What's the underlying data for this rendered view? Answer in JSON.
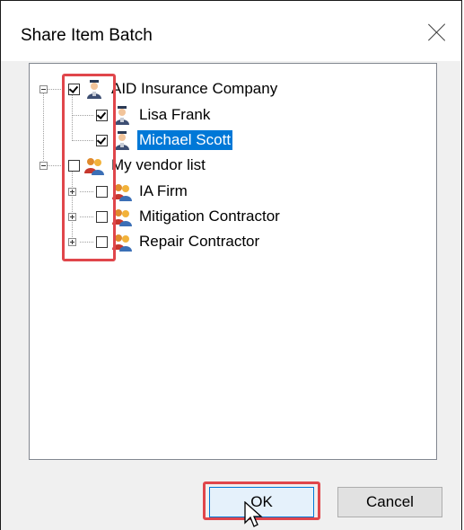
{
  "dialog": {
    "title": "Share Item Batch",
    "close_icon": "close-icon"
  },
  "tree": {
    "items": [
      {
        "label": "AID Insurance Company",
        "checked": true,
        "expanded": true,
        "icon": "user-icon",
        "selected": false
      },
      {
        "label": "Lisa Frank",
        "checked": true,
        "icon": "user-icon",
        "selected": false
      },
      {
        "label": "Michael Scott",
        "checked": true,
        "icon": "user-icon",
        "selected": true
      },
      {
        "label": "My vendor list",
        "checked": false,
        "expanded": true,
        "icon": "group-icon",
        "selected": false
      },
      {
        "label": "IA Firm",
        "checked": false,
        "expanded": false,
        "icon": "group-icon",
        "selected": false
      },
      {
        "label": "Mitigation Contractor",
        "checked": false,
        "expanded": false,
        "icon": "group-icon",
        "selected": false
      },
      {
        "label": "Repair Contractor",
        "checked": false,
        "expanded": false,
        "icon": "group-icon",
        "selected": false
      }
    ]
  },
  "buttons": {
    "ok_label": "OK",
    "cancel_label": "Cancel"
  },
  "colors": {
    "highlight_box": "#e0464b",
    "selection": "#0078d7"
  }
}
